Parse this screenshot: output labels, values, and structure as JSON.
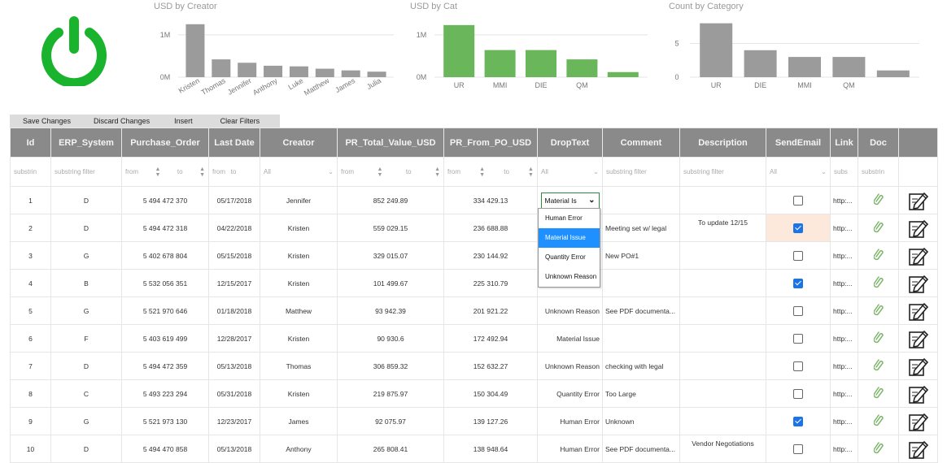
{
  "colors": {
    "gray_bar": "#9b9b9b",
    "green_bar": "#6ab65a",
    "power": "#19b32e",
    "header_bg": "#8a8a8a",
    "selected_blue": "#1e90ff"
  },
  "power_button": {
    "icon": "power-icon"
  },
  "charts": [
    {
      "title": "USD by Creator",
      "y_ticks": [
        "1M",
        "0M"
      ],
      "categories": [
        "Kristen",
        "Thomas",
        "Jennifer",
        "Anthony",
        "Luke",
        "Matthew",
        "James",
        "Julia"
      ]
    },
    {
      "title": "USD by Cat",
      "y_ticks": [
        "1M",
        "0M"
      ],
      "categories": [
        "UR",
        "MMI",
        "DIE",
        "QM",
        ""
      ]
    },
    {
      "title": "Count by Category",
      "y_ticks": [
        "5",
        "0"
      ],
      "categories": [
        "UR",
        "DIE",
        "MMI",
        "QM",
        ""
      ]
    }
  ],
  "chart_data": [
    {
      "type": "bar",
      "title": "USD by Creator",
      "categories": [
        "Kristen",
        "Thomas",
        "Jennifer",
        "Anthony",
        "Luke",
        "Matthew",
        "James",
        "Julia"
      ],
      "values": [
        1250000,
        420000,
        340000,
        270000,
        255000,
        200000,
        160000,
        130000
      ],
      "ylim": [
        0,
        1400000
      ],
      "color": "#9b9b9b"
    },
    {
      "type": "bar",
      "title": "USD by Cat",
      "categories": [
        "UR",
        "MMI",
        "DIE",
        "QM",
        ""
      ],
      "values": [
        1230000,
        640000,
        640000,
        420000,
        120000
      ],
      "ylim": [
        0,
        1400000
      ],
      "color": "#6ab65a"
    },
    {
      "type": "bar",
      "title": "Count by Category",
      "categories": [
        "UR",
        "DIE",
        "MMI",
        "QM",
        ""
      ],
      "values": [
        8,
        4,
        3,
        3,
        1
      ],
      "ylim": [
        0,
        8.8
      ],
      "color": "#9b9b9b"
    }
  ],
  "toolbar": {
    "save": "Save Changes",
    "discard": "Discard Changes",
    "insert": "Insert",
    "clear": "Clear Filters"
  },
  "columns": [
    "Id",
    "ERP_System",
    "Purchase_Order",
    "Last Date",
    "Creator",
    "PR_Total_Value_USD",
    "PR_From_PO_USD",
    "DropText",
    "Comment",
    "Description",
    "SendEmail",
    "Link",
    "Doc",
    ""
  ],
  "filters": {
    "substr": "substrin",
    "substring": "substring filter",
    "sub": "subs",
    "from": "from",
    "to": "to",
    "all": "All"
  },
  "rows": [
    {
      "id": "1",
      "erp": "D",
      "po": "5 494 472 370",
      "date": "05/17/2018",
      "creator": "Jennifer",
      "total": "852 249.89",
      "from_po": "334 429.13",
      "drop": "Material Is",
      "comment": "",
      "desc": "",
      "email": false,
      "link": "http:..."
    },
    {
      "id": "2",
      "erp": "D",
      "po": "5 494 472 318",
      "date": "04/22/2018",
      "creator": "Kristen",
      "total": "559 029.15",
      "from_po": "236 688.88",
      "drop": "",
      "comment": "Meeting set w/ legal",
      "desc": "To update 12/15",
      "email": true,
      "link": "http:..."
    },
    {
      "id": "3",
      "erp": "G",
      "po": "5 402 678 804",
      "date": "05/15/2018",
      "creator": "Kristen",
      "total": "329 015.07",
      "from_po": "230 144.92",
      "drop": "",
      "comment": "New PO#1",
      "desc": "",
      "email": false,
      "link": "http:..."
    },
    {
      "id": "4",
      "erp": "B",
      "po": "5 532 056 351",
      "date": "12/15/2017",
      "creator": "Kristen",
      "total": "101 499.67",
      "from_po": "225 310.79",
      "drop": "",
      "comment": "",
      "desc": "",
      "email": true,
      "link": "http:..."
    },
    {
      "id": "5",
      "erp": "G",
      "po": "5 521 970 646",
      "date": "01/18/2018",
      "creator": "Matthew",
      "total": "93 942.39",
      "from_po": "201 921.22",
      "drop": "Unknown Reason",
      "comment": "See PDF documenta...",
      "desc": "",
      "email": false,
      "link": "http:..."
    },
    {
      "id": "6",
      "erp": "F",
      "po": "5 403 619 499",
      "date": "12/28/2017",
      "creator": "Kristen",
      "total": "90 930.6",
      "from_po": "172 492.94",
      "drop": "Material Issue",
      "comment": "",
      "desc": "",
      "email": false,
      "link": "http:..."
    },
    {
      "id": "7",
      "erp": "D",
      "po": "5 494 472 359",
      "date": "05/13/2018",
      "creator": "Thomas",
      "total": "306 859.32",
      "from_po": "152 632.27",
      "drop": "Unknown Reason",
      "comment": "checking with legal",
      "desc": "",
      "email": false,
      "link": "http:..."
    },
    {
      "id": "8",
      "erp": "C",
      "po": "5 493 223 294",
      "date": "05/31/2018",
      "creator": "Kristen",
      "total": "219 875.97",
      "from_po": "150 304.49",
      "drop": "Quantity Error",
      "comment": "Too Large",
      "desc": "",
      "email": false,
      "link": "http:..."
    },
    {
      "id": "9",
      "erp": "G",
      "po": "5 521 973 130",
      "date": "12/23/2017",
      "creator": "James",
      "total": "92 075.97",
      "from_po": "139 127.26",
      "drop": "Human Error",
      "comment": "Unknown",
      "desc": "",
      "email": true,
      "link": "http:..."
    },
    {
      "id": "10",
      "erp": "D",
      "po": "5 494 470 858",
      "date": "05/13/2018",
      "creator": "Anthony",
      "total": "265 808.41",
      "from_po": "138 948.64",
      "drop": "Human Error",
      "comment": "See PDF documenta...",
      "desc": "Vendor Negotiations",
      "email": false,
      "link": "http:..."
    }
  ],
  "dropdown": {
    "options": [
      "Human Error",
      "Material Issue",
      "Quantity Error",
      "Unknown Reason"
    ],
    "selected": "Material Issue"
  }
}
